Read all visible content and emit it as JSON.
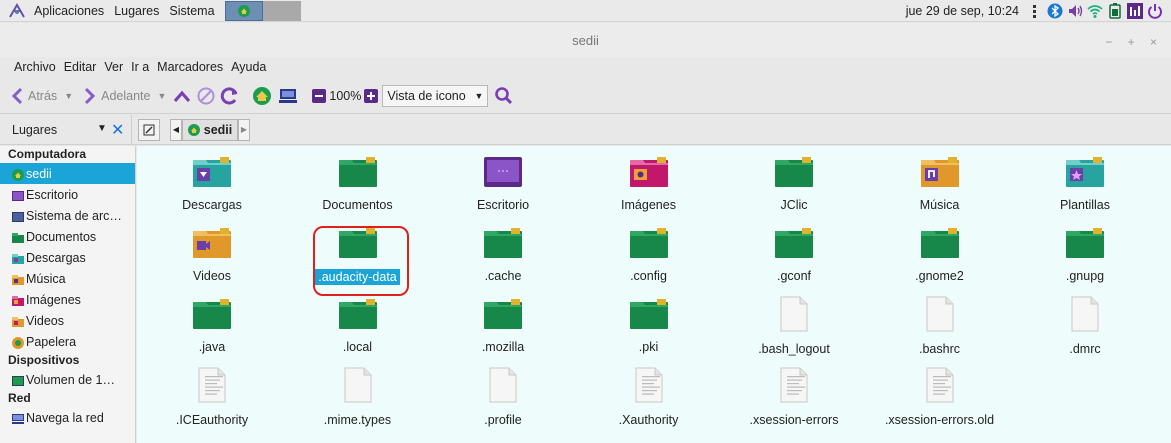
{
  "top_panel": {
    "menus": [
      "Aplicaciones",
      "Lugares",
      "Sistema"
    ],
    "clock": "jue 29 de sep, 10:24"
  },
  "window": {
    "title": "sedii",
    "controls": "− + ×"
  },
  "menubar": [
    "Archivo",
    "Editar",
    "Ver",
    "Ir a",
    "Marcadores",
    "Ayuda"
  ],
  "toolbar": {
    "back": "Atrás",
    "forward": "Adelante",
    "zoom": "100%",
    "view": "Vista de icono"
  },
  "location": {
    "places_label": "Lugares",
    "current": "sedii"
  },
  "sidebar": {
    "sections": [
      {
        "title": "Computadora",
        "items": [
          {
            "label": "sedii",
            "icon": "home-icon"
          },
          {
            "label": "Escritorio",
            "icon": "desktop-icon"
          },
          {
            "label": "Sistema de arc…",
            "icon": "drive-icon"
          },
          {
            "label": "Documentos",
            "icon": "folder-icon"
          },
          {
            "label": "Descargas",
            "icon": "downloads-folder-icon"
          },
          {
            "label": "Música",
            "icon": "music-folder-icon"
          },
          {
            "label": "Imágenes",
            "icon": "pictures-folder-icon"
          },
          {
            "label": "Videos",
            "icon": "videos-folder-icon"
          },
          {
            "label": "Papelera",
            "icon": "trash-icon"
          }
        ]
      },
      {
        "title": "Dispositivos",
        "items": [
          {
            "label": "Volumen de 1…",
            "icon": "volume-icon"
          }
        ]
      },
      {
        "title": "Red",
        "items": [
          {
            "label": "Navega la red",
            "icon": "network-icon"
          }
        ]
      }
    ]
  },
  "files": [
    {
      "name": "Descargas",
      "kind": "downloads"
    },
    {
      "name": "Documentos",
      "kind": "folder"
    },
    {
      "name": "Escritorio",
      "kind": "desktop"
    },
    {
      "name": "Imágenes",
      "kind": "pictures"
    },
    {
      "name": "JClic",
      "kind": "folder"
    },
    {
      "name": "Música",
      "kind": "music"
    },
    {
      "name": "Plantillas",
      "kind": "templates"
    },
    {
      "name": "Videos",
      "kind": "videos"
    },
    {
      "name": ".audacity-data",
      "kind": "folder",
      "selected": true
    },
    {
      "name": ".cache",
      "kind": "folder"
    },
    {
      "name": ".config",
      "kind": "folder"
    },
    {
      "name": ".gconf",
      "kind": "folder"
    },
    {
      "name": ".gnome2",
      "kind": "folder"
    },
    {
      "name": ".gnupg",
      "kind": "folder"
    },
    {
      "name": ".java",
      "kind": "folder"
    },
    {
      "name": ".local",
      "kind": "folder"
    },
    {
      "name": ".mozilla",
      "kind": "folder"
    },
    {
      "name": ".pki",
      "kind": "folder"
    },
    {
      "name": ".bash_logout",
      "kind": "file"
    },
    {
      "name": ".bashrc",
      "kind": "file"
    },
    {
      "name": ".dmrc",
      "kind": "file"
    },
    {
      "name": ".ICEauthority",
      "kind": "textfile"
    },
    {
      "name": ".mime.types",
      "kind": "file"
    },
    {
      "name": ".profile",
      "kind": "file"
    },
    {
      "name": ".Xauthority",
      "kind": "textfile"
    },
    {
      "name": ".xsession-errors",
      "kind": "textfile"
    },
    {
      "name": ".xsession-errors.old",
      "kind": "textfile"
    }
  ],
  "colors": {
    "folder": "#17874a",
    "folder_tab": "#2fa863",
    "folder_sticker": "#e0b22d",
    "accent": "#1aa4d8",
    "highlight_ring": "#e0201c"
  }
}
